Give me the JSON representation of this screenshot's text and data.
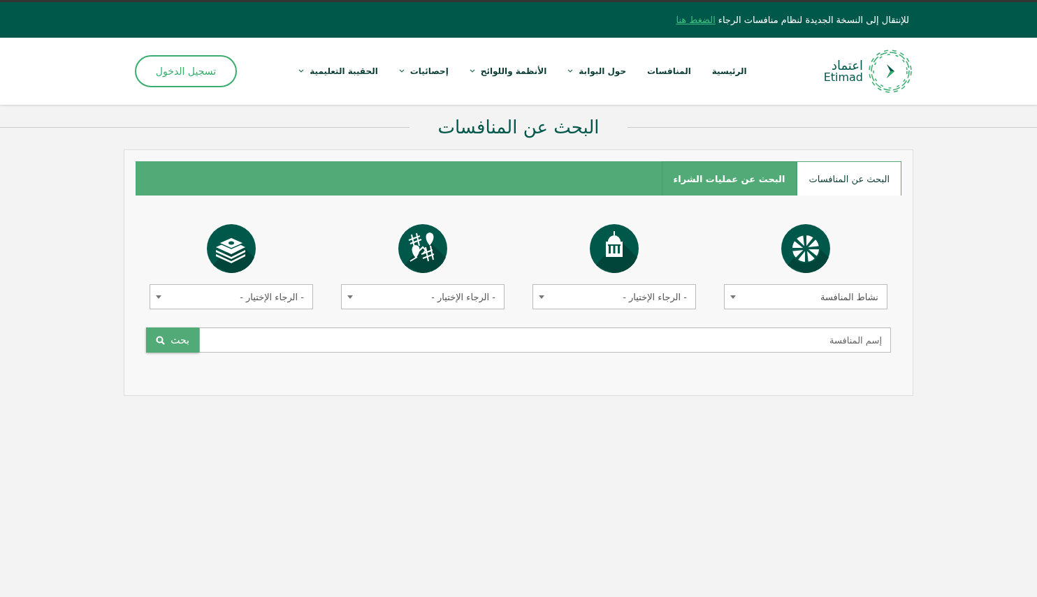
{
  "banner": {
    "text": "للإنتقال إلى النسخة الجديدة لنظام منافسات الرجاء",
    "link": "الضغط هنا"
  },
  "header": {
    "logo": {
      "arabic": "اعتماد",
      "latin": "Etimad"
    },
    "nav": [
      {
        "label": "الرئيسية",
        "dropdown": false
      },
      {
        "label": "المنافسات",
        "dropdown": false
      },
      {
        "label": "حول البوابة",
        "dropdown": true
      },
      {
        "label": "الأنظمة واللوائح",
        "dropdown": true
      },
      {
        "label": "إحصائيات",
        "dropdown": true
      },
      {
        "label": "الحقيبة التعليمية",
        "dropdown": true
      }
    ],
    "login_button": "تسجيل الدخول"
  },
  "page_title": "البحث عن المنافسات",
  "tabs": [
    {
      "label": "البحث عن المنافسات",
      "selected": true
    },
    {
      "label": "البحث عن عمليات الشراء",
      "selected": false
    }
  ],
  "filters": [
    {
      "kind": "pie",
      "value": "نشاط المنافسة"
    },
    {
      "kind": "building",
      "value": "- الرجاء الإختيار -"
    },
    {
      "kind": "map",
      "value": "- الرجاء الإختيار -"
    },
    {
      "kind": "cash",
      "value": "- الرجاء الإختيار -"
    }
  ],
  "search": {
    "placeholder": "إسم المنافسة",
    "button": "بحث"
  }
}
